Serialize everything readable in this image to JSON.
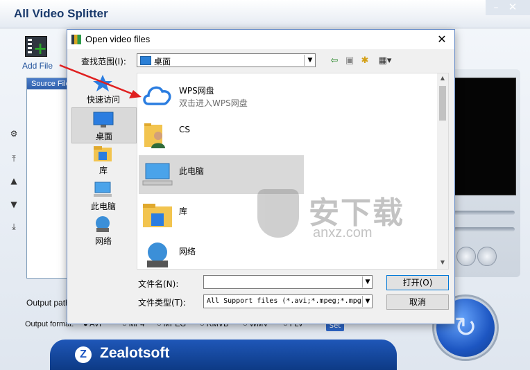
{
  "app": {
    "title": "All Video Splitter",
    "add_file_label": "Add File",
    "source_header": "Source File",
    "output_path_label": "Output path:",
    "output_format_label": "Output format:",
    "formats": [
      "AVI",
      "MP4",
      "MPEG",
      "RMVB",
      "WMV",
      "FLV"
    ],
    "selected_format": "AVI",
    "set_label": "Set",
    "brand": "Zealotsoft",
    "brand_logo_letter": "Z",
    "window_min_glyph": "–",
    "window_close_glyph": "✕"
  },
  "dialog": {
    "title": "Open video files",
    "close_glyph": "✕",
    "look_in_label": "查找范围(I):",
    "look_in_value": "桌面",
    "places": [
      {
        "label": "快速访问",
        "icon": "star-icon"
      },
      {
        "label": "桌面",
        "icon": "desktop-icon"
      },
      {
        "label": "库",
        "icon": "library-icon"
      },
      {
        "label": "此电脑",
        "icon": "computer-icon"
      },
      {
        "label": "网络",
        "icon": "network-icon"
      }
    ],
    "files": [
      {
        "name": "WPS网盘",
        "sub": "双击进入WPS网盘",
        "icon": "cloud-icon"
      },
      {
        "name": "CS",
        "sub": "",
        "icon": "user-folder-icon"
      },
      {
        "name": "此电脑",
        "sub": "",
        "icon": "computer-icon"
      },
      {
        "name": "库",
        "sub": "",
        "icon": "library-icon"
      },
      {
        "name": "网络",
        "sub": "",
        "icon": "network-icon"
      }
    ],
    "filename_label": "文件名(N):",
    "filename_value": "",
    "filetype_label": "文件类型(T):",
    "filetype_value": "All Support files (*.avi;*.mpeg;*.mpg",
    "open_label": "打开(O)",
    "cancel_label": "取消"
  },
  "watermark": {
    "text_cn": "安下载",
    "text_en": "anxz.com"
  },
  "colors": {
    "accent": "#1d56c2",
    "arrow": "#e02020",
    "dialog_border": "#6b8fc9",
    "cloud": "#2b7de0"
  }
}
